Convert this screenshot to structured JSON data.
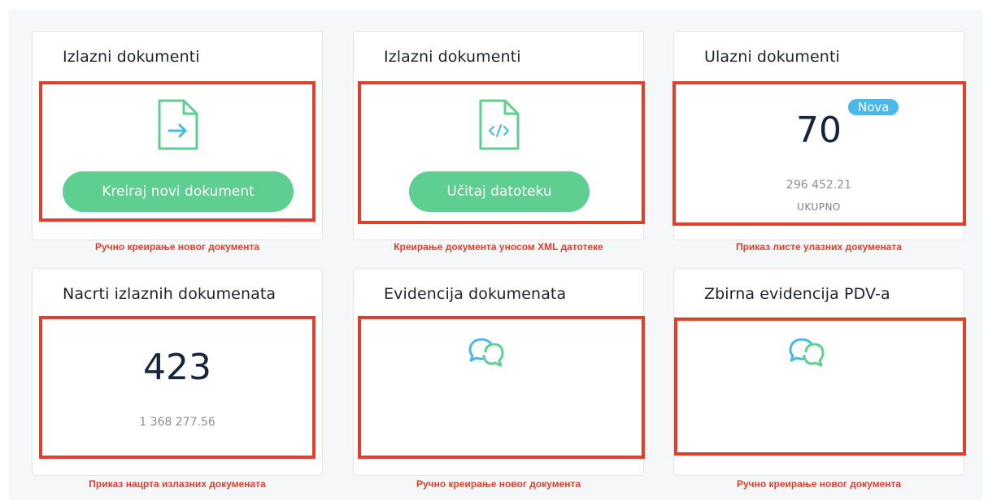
{
  "cards": [
    {
      "title": "Izlazni dokumenti",
      "button": "Kreiraj novi dokument",
      "caption": "Ручно креирање новог документа"
    },
    {
      "title": "Izlazni dokumenti",
      "button": "Učitaj datoteku",
      "caption": "Креирање документа уносом XML датотеке"
    },
    {
      "title": "Ulazni dokumenti",
      "count": "70",
      "badge": "Nova",
      "amount": "296 452.21",
      "label": "UKUPNO",
      "caption": "Приказ листе улазних докумената"
    },
    {
      "title": "Nacrti izlaznih dokumenata",
      "count": "423",
      "amount": "1 368 277.56",
      "caption": "Приказ нацрта излазних докумената"
    },
    {
      "title": "Evidencija dokumenata",
      "caption": "Ручно креирање новог документа"
    },
    {
      "title": "Zbirna evidencija PDV-a",
      "caption": "Ручно креирање новог документа"
    }
  ],
  "colors": {
    "accent_green": "#5fce91",
    "highlight_red": "#e23f2a",
    "badge_blue": "#49b8ea",
    "icon_blue": "#49b8ea"
  },
  "icons": [
    "file-arrow-icon",
    "file-code-icon",
    "chat-bubbles-icon"
  ]
}
